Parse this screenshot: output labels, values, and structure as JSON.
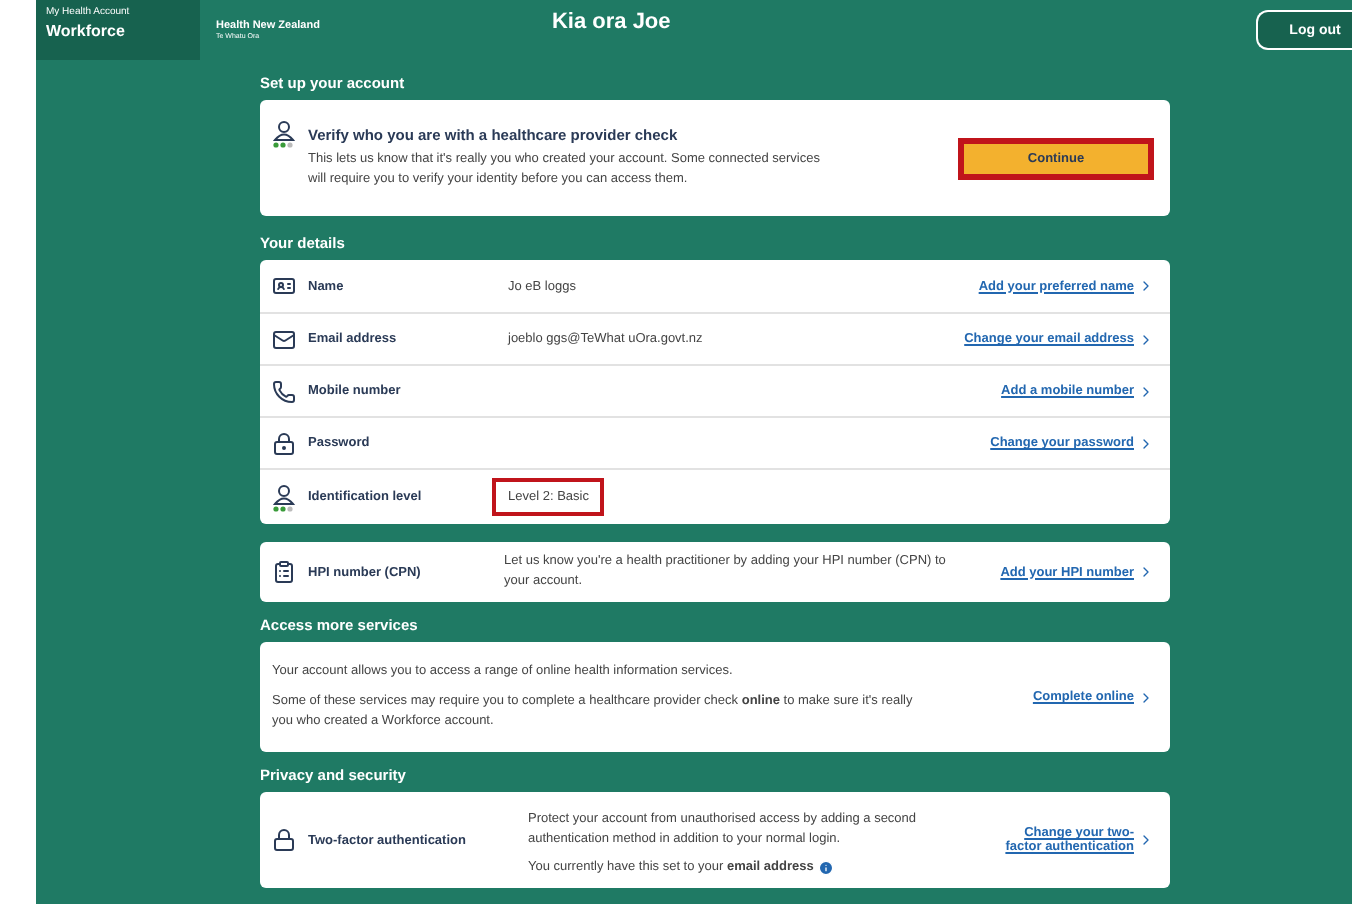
{
  "header": {
    "brand_small": "My Health Account",
    "brand": "Workforce",
    "org": "Health New Zealand",
    "org_sub": "Te Whatu Ora",
    "greeting": "Kia ora Joe",
    "logout": "Log out"
  },
  "setup": {
    "title": "Set up your account",
    "card_title": "Verify who you are with a healthcare provider check",
    "text": "This lets us know that it's really you who created your account. Some connected services will require you to verify your identity before you can access them.",
    "button": {
      "label": "Continue",
      "highlighted": true
    }
  },
  "details": {
    "title": "Your details",
    "rows": [
      {
        "kind": "name",
        "label": "Name",
        "value": "Jo eB loggs",
        "link": "Add your preferred name"
      },
      {
        "kind": "email",
        "label": "Email address",
        "value": "joeblo ggs@TeWhat uOra.govt.nz",
        "link": "Change your email address"
      },
      {
        "kind": "mobile",
        "label": "Mobile number",
        "link": "Add a mobile number"
      },
      {
        "kind": "password",
        "label": "Password",
        "link": "Change your password"
      },
      {
        "kind": "identification",
        "label": "Identification level",
        "value": "Level 2: Basic",
        "highlighted": true
      }
    ]
  },
  "hpi": {
    "label": "HPI number (CPN)",
    "text": "Let us know you're a health practitioner by adding your HPI number (CPN) to your account.",
    "link": "Add your HPI number"
  },
  "services": {
    "title": "Access more services",
    "paragraphs": [
      "Your account allows you to access a range of online health information services.",
      "Some of these services may require you to complete a healthcare provider check **online** to make sure it's really you who created a Workforce account."
    ],
    "link": "Complete online"
  },
  "privacy": {
    "title": "Privacy and security",
    "rows": [
      {
        "label": "Two-factor authentication",
        "text": "Protect your account from unauthorised access by adding a second authentication method in addition to your normal login.",
        "note": "You currently have this set to your **email address**",
        "link": "Change your two-factor authentication"
      }
    ]
  }
}
